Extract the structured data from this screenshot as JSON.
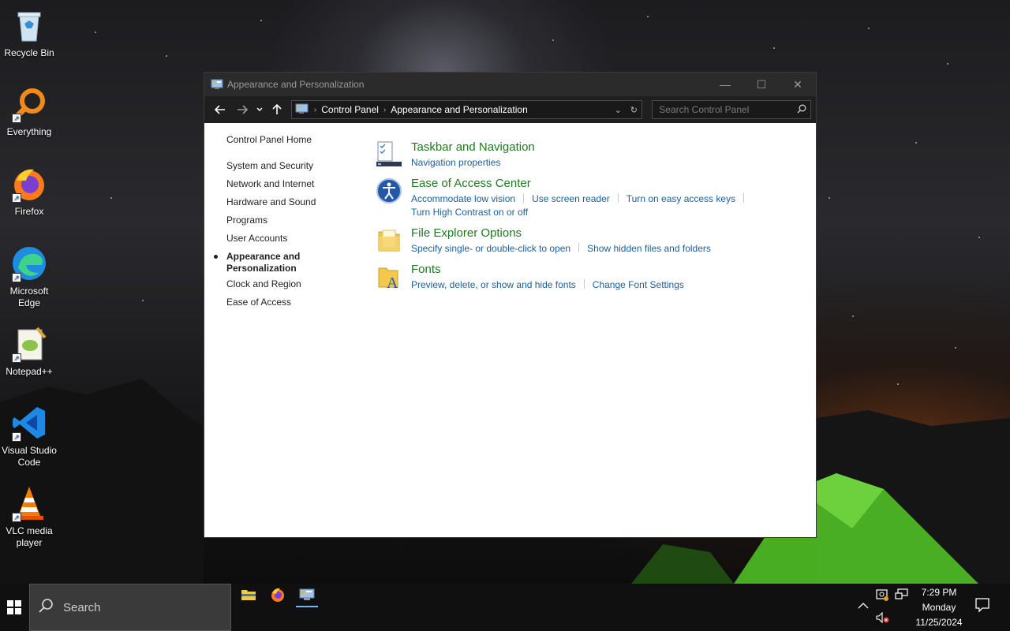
{
  "desktop": {
    "icons": [
      {
        "label": "Recycle Bin"
      },
      {
        "label": "Everything"
      },
      {
        "label": "Firefox"
      },
      {
        "label": "Microsoft Edge"
      },
      {
        "label": "Notepad++"
      },
      {
        "label": "Visual Studio Code"
      },
      {
        "label": "VLC media player"
      }
    ]
  },
  "window": {
    "title": "Appearance and Personalization",
    "breadcrumb": [
      "Control Panel",
      "Appearance and Personalization"
    ],
    "search_placeholder": "Search Control Panel",
    "leftnav": {
      "home": "Control Panel Home",
      "items": [
        "System and Security",
        "Network and Internet",
        "Hardware and Sound",
        "Programs",
        "User Accounts",
        "Appearance and Personalization",
        "Clock and Region",
        "Ease of Access"
      ],
      "active_index": 5
    },
    "categories": [
      {
        "title": "Taskbar and Navigation",
        "icon": "taskbar-icon",
        "links": [
          "Navigation properties"
        ]
      },
      {
        "title": "Ease of Access Center",
        "icon": "ease-of-access-icon",
        "links": [
          "Accommodate low vision",
          "Use screen reader",
          "Turn on easy access keys",
          "Turn High Contrast on or off"
        ]
      },
      {
        "title": "File Explorer Options",
        "icon": "folder-options-icon",
        "links": [
          "Specify single- or double-click to open",
          "Show hidden files and folders"
        ]
      },
      {
        "title": "Fonts",
        "icon": "fonts-folder-icon",
        "links": [
          "Preview, delete, or show and hide fonts",
          "Change Font Settings"
        ]
      }
    ]
  },
  "taskbar": {
    "search_label": "Search",
    "apps": [
      "file-explorer-icon",
      "firefox-icon",
      "control-panel-icon"
    ],
    "clock": {
      "time": "7:29 PM",
      "day": "Monday",
      "date": "11/25/2024"
    }
  }
}
